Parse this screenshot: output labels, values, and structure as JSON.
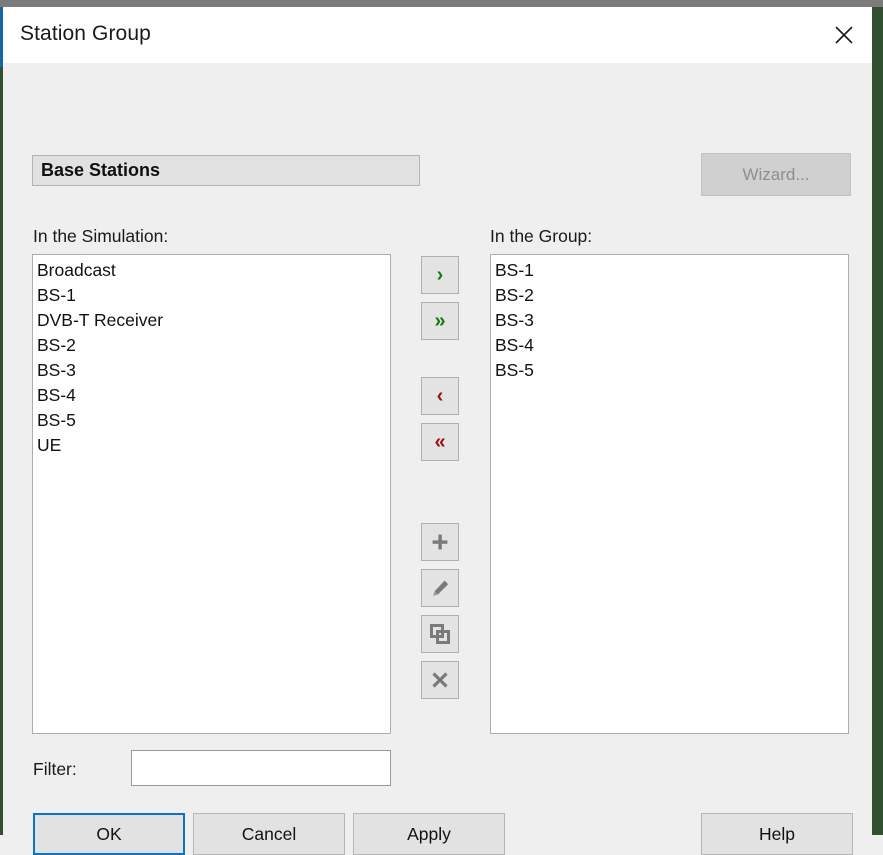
{
  "window": {
    "title": "Station Group",
    "close_icon": "close-icon"
  },
  "group_header": {
    "label": "Base Stations"
  },
  "wizard": {
    "label": "Wizard...",
    "enabled": false
  },
  "lists": {
    "simulation": {
      "caption": "In the Simulation:",
      "items": [
        "Broadcast",
        "BS-1",
        "DVB-T Receiver",
        "BS-2",
        "BS-3",
        "BS-4",
        "BS-5",
        "UE"
      ]
    },
    "group": {
      "caption": "In the Group:",
      "items": [
        "BS-1",
        "BS-2",
        "BS-3",
        "BS-4",
        "BS-5"
      ]
    }
  },
  "transfer_buttons": [
    {
      "name": "move-right",
      "glyph": "›",
      "icon": "chevron-right-icon",
      "color": "#137a13"
    },
    {
      "name": "move-all-right",
      "glyph": "»",
      "icon": "double-chevron-right-icon",
      "color": "#137a13"
    },
    {
      "name": "move-left",
      "glyph": "‹",
      "icon": "chevron-left-icon",
      "color": "#9b1019"
    },
    {
      "name": "move-all-left",
      "glyph": "«",
      "icon": "double-chevron-left-icon",
      "color": "#9b1019"
    }
  ],
  "action_buttons": [
    {
      "name": "add",
      "icon": "plus-icon",
      "color": "#7a7a7a"
    },
    {
      "name": "edit",
      "icon": "pencil-icon",
      "color": "#7a7a7a"
    },
    {
      "name": "duplicate",
      "icon": "copy-icon",
      "color": "#7a7a7a"
    },
    {
      "name": "delete",
      "icon": "x-icon",
      "color": "#7a7a7a"
    }
  ],
  "filter": {
    "label": "Filter:",
    "value": "",
    "placeholder": ""
  },
  "footer": {
    "ok": "OK",
    "cancel": "Cancel",
    "apply": "Apply",
    "help": "Help"
  },
  "colors": {
    "accent_focus": "#0f72c4",
    "add_green": "#137a13",
    "remove_red": "#9b1019",
    "icon_gray": "#7a7a7a",
    "dialog_bg": "#efefef"
  }
}
